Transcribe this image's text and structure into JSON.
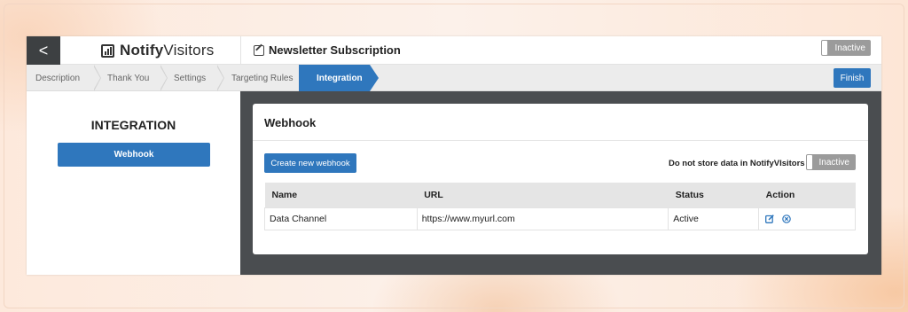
{
  "header": {
    "back_label": "<",
    "logo_bold": "Notify",
    "logo_regular": "Visitors",
    "page_title": "Newsletter Subscription",
    "status_toggle": "Inactive"
  },
  "steps": [
    {
      "label": "Description",
      "active": false
    },
    {
      "label": "Thank You",
      "active": false
    },
    {
      "label": "Settings",
      "active": false
    },
    {
      "label": "Targeting Rules",
      "active": false
    },
    {
      "label": "Integration",
      "active": true
    }
  ],
  "finish_label": "Finish",
  "left_panel": {
    "title": "INTEGRATION",
    "button": "Webhook"
  },
  "webhook": {
    "title": "Webhook",
    "create_button": "Create new webhook",
    "store_label": "Do not store data in NotifyVIsitors",
    "store_toggle": "Inactive",
    "columns": [
      "Name",
      "URL",
      "Status",
      "Action"
    ],
    "rows": [
      {
        "name": "Data Channel",
        "url": "https://www.myurl.com",
        "status": "Active",
        "actions": [
          "edit-icon",
          "close-circle-icon"
        ]
      }
    ]
  },
  "colors": {
    "accent": "#2f77bd",
    "dark_panel": "#4a4d50",
    "toggle_off": "#9b9b9b",
    "background": "#fbe9dc"
  }
}
